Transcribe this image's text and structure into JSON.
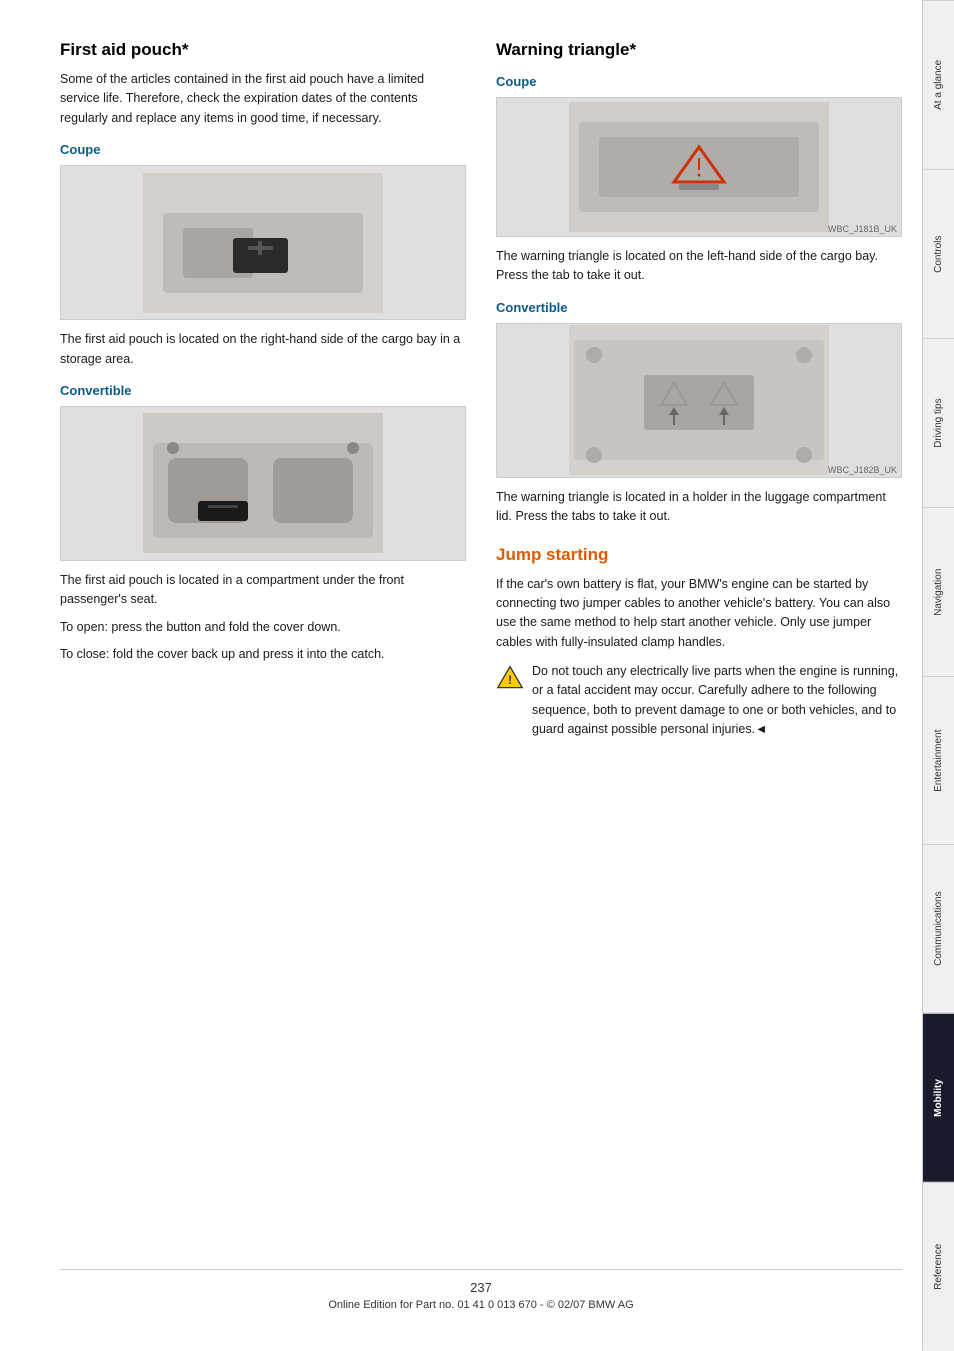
{
  "page": {
    "number": "237",
    "footer_text": "Online Edition for Part no. 01 41 0 013 670 - © 02/07 BMW AG"
  },
  "tabs": [
    {
      "id": "at-a-glance",
      "label": "At a glance",
      "active": false
    },
    {
      "id": "controls",
      "label": "Controls",
      "active": false
    },
    {
      "id": "driving-tips",
      "label": "Driving tips",
      "active": false
    },
    {
      "id": "navigation",
      "label": "Navigation",
      "active": false
    },
    {
      "id": "entertainment",
      "label": "Entertainment",
      "active": false
    },
    {
      "id": "communications",
      "label": "Communications",
      "active": false
    },
    {
      "id": "mobility",
      "label": "Mobility",
      "active": true
    },
    {
      "id": "reference",
      "label": "Reference",
      "active": false
    }
  ],
  "left_col": {
    "section_title": "First aid pouch*",
    "intro_text": "Some of the articles contained in the first aid pouch have a limited service life. Therefore, check the expiration dates of the contents regularly and replace any items in good time, if necessary.",
    "coupe_label": "Coupe",
    "coupe_image_alt": "First aid pouch coupe image",
    "coupe_caption": "The first aid pouch is located on the right-hand side of the cargo bay in a storage area.",
    "convertible_label": "Convertible",
    "convertible_image_alt": "First aid pouch convertible image",
    "convertible_caption": "The first aid pouch is located in a compartment under the front passenger's seat.",
    "open_text": "To open: press the button and fold the cover down.",
    "close_text": "To close: fold the cover back up and press it into the catch."
  },
  "right_col": {
    "section_title": "Warning triangle*",
    "coupe_label": "Coupe",
    "coupe_image_alt": "Warning triangle coupe image",
    "coupe_caption": "The warning triangle is located on the left-hand side of the cargo bay. Press the tab to take it out.",
    "convertible_label": "Convertible",
    "convertible_image_alt": "Warning triangle convertible image",
    "convertible_caption": "The warning triangle is located in a holder in the luggage compartment lid. Press the tabs to take it out.",
    "jump_title": "Jump starting",
    "jump_text": "If the car's own battery is flat, your BMW's engine can be started by connecting two jumper cables to another vehicle's battery. You can also use the same method to help start another vehicle. Only use jumper cables with fully-insulated clamp handles.",
    "warning_text": "Do not touch any electrically live parts when the engine is running, or a fatal accident may occur. Carefully adhere to the following sequence, both to prevent damage to one or both vehicles, and to guard against possible personal injuries.◄"
  }
}
